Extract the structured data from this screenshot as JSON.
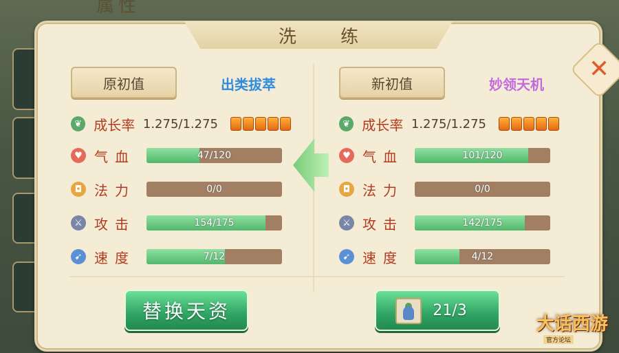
{
  "background_title": "属性",
  "dialog": {
    "title": "洗 练",
    "close_label": "✕"
  },
  "left": {
    "header": "原初值",
    "grade": "出类拔萃",
    "grade_color": "#2e8be0",
    "growth_label": "成长率",
    "growth_value": "1.275/1.275",
    "growth_stars": 5,
    "stats": [
      {
        "label": "气血",
        "value": "47/120",
        "fraction": 0.39,
        "icon": "heart-icon",
        "color": "#e46b5a"
      },
      {
        "label": "法力",
        "value": "0/0",
        "fraction": 0,
        "icon": "mana-icon",
        "color": "#e6a642"
      },
      {
        "label": "攻击",
        "value": "154/175",
        "fraction": 0.88,
        "icon": "sword-icon",
        "color": "#7a86a8"
      },
      {
        "label": "速度",
        "value": "7/12",
        "fraction": 0.58,
        "icon": "speed-icon",
        "color": "#5b8fd6"
      }
    ]
  },
  "right": {
    "header": "新初值",
    "grade": "妙领天机",
    "grade_color": "#c06ae0",
    "growth_label": "成长率",
    "growth_value": "1.275/1.275",
    "growth_stars": 5,
    "stats": [
      {
        "label": "气血",
        "value": "101/120",
        "fraction": 0.84,
        "icon": "heart-icon",
        "color": "#e46b5a"
      },
      {
        "label": "法力",
        "value": "0/0",
        "fraction": 0,
        "icon": "mana-icon",
        "color": "#e6a642"
      },
      {
        "label": "攻击",
        "value": "142/175",
        "fraction": 0.81,
        "icon": "sword-icon",
        "color": "#7a86a8"
      },
      {
        "label": "速度",
        "value": "4/12",
        "fraction": 0.33,
        "icon": "speed-icon",
        "color": "#5b8fd6"
      }
    ]
  },
  "actions": {
    "replace_label": "替换天资",
    "count_label": "21/3"
  },
  "logo": {
    "text": "大话西游",
    "sub": "官方论坛"
  }
}
